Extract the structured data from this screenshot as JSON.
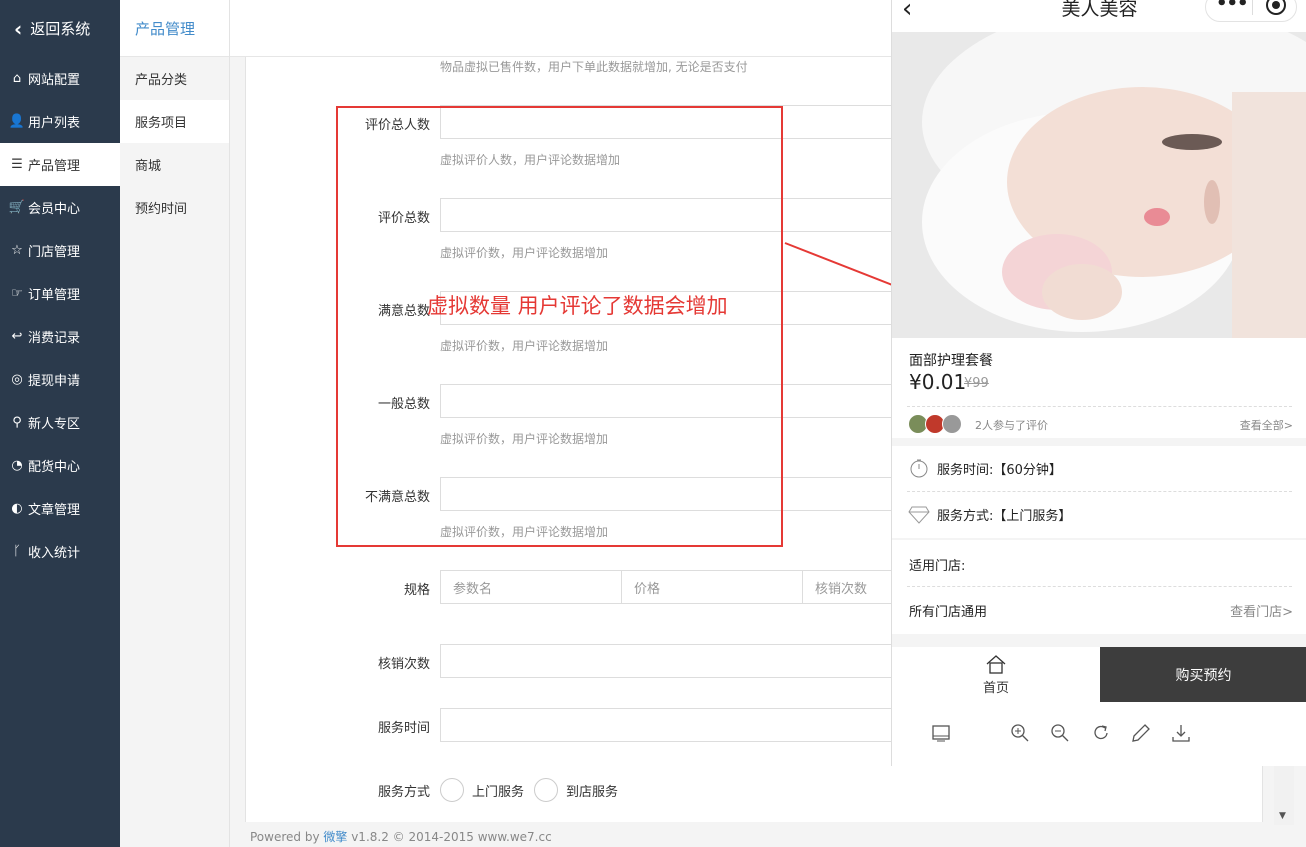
{
  "sidebar": {
    "back_label": "返回系统",
    "items": [
      {
        "label": "网站配置",
        "icon": "home-icon"
      },
      {
        "label": "用户列表",
        "icon": "user-icon"
      },
      {
        "label": "产品管理",
        "icon": "list-icon",
        "active": true
      },
      {
        "label": "会员中心",
        "icon": "cart-icon"
      },
      {
        "label": "门店管理",
        "icon": "star-icon"
      },
      {
        "label": "订单管理",
        "icon": "hand-icon"
      },
      {
        "label": "消费记录",
        "icon": "reply-icon"
      },
      {
        "label": "提现申请",
        "icon": "wechat-icon"
      },
      {
        "label": "新人专区",
        "icon": "pin-icon"
      },
      {
        "label": "配货中心",
        "icon": "pie-icon"
      },
      {
        "label": "文章管理",
        "icon": "contrast-icon"
      },
      {
        "label": "收入统计",
        "icon": "fork-icon"
      }
    ]
  },
  "submenu": {
    "title": "产品管理",
    "items": [
      "产品分类",
      "服务项目",
      "商城",
      "预约时间"
    ]
  },
  "form": {
    "top_help": "物品虚拟已售件数，用户下单此数据就增加, 无论是否支付",
    "fields": [
      {
        "label": "评价总人数",
        "help": "虚拟评价人数，用户评论数据增加"
      },
      {
        "label": "评价总数",
        "help": "虚拟评价数，用户评论数据增加"
      },
      {
        "label": "满意总数",
        "help": "虚拟评价数，用户评论数据增加"
      },
      {
        "label": "一般总数",
        "help": "虚拟评价数，用户评论数据增加"
      },
      {
        "label": "不满意总数",
        "help": "虚拟评价数，用户评论数据增加"
      }
    ],
    "spec_label": "规格",
    "spec_placeholders": [
      "参数名",
      "价格",
      "核销次数"
    ],
    "verify_label": "核销次数",
    "service_time_label": "服务时间",
    "service_mode_label": "服务方式",
    "service_mode_options": [
      "上门服务",
      "到店服务"
    ]
  },
  "annotation": "虚拟数量 用户评论了数据会增加",
  "footer": {
    "prefix": "Powered by ",
    "brand": "微擎",
    "rest": " v1.8.2 © 2014-2015 www.we7.cc"
  },
  "preview": {
    "title": "美人美容",
    "product_name": "面部护理套餐",
    "price": "¥0.01",
    "old_price": "¥99",
    "joined_text": "2人参与了评价",
    "view_all": "查看全部>",
    "service_time": "服务时间:【60分钟】",
    "service_mode": "服务方式:【上门服务】",
    "stores_title": "适用门店:",
    "stores_all": "所有门店通用",
    "stores_view": "查看门店>",
    "home_label": "首页",
    "buy_label": "购买预约"
  },
  "colors": {
    "sidebar_bg": "#2b3a4c",
    "annotation": "#e53935",
    "brand": "#428bca",
    "buy_bg": "#3d3d3d"
  }
}
